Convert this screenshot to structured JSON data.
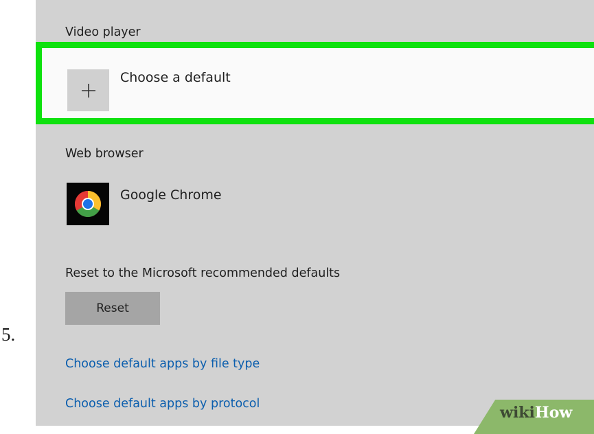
{
  "step_number": "5.",
  "video_player": {
    "section_label": "Video player",
    "choose_default_label": "Choose a default"
  },
  "web_browser": {
    "section_label": "Web browser",
    "app_name": "Google Chrome",
    "app_icon": "chrome-logo-icon"
  },
  "reset": {
    "section_label": "Reset to the Microsoft recommended defaults",
    "button_label": "Reset"
  },
  "links": {
    "by_file_type": "Choose default apps by file type",
    "by_protocol": "Choose default apps by protocol"
  },
  "watermark": {
    "part1": "wiki",
    "part2": "How"
  },
  "colors": {
    "highlight": "#0ee10e",
    "panel_background": "#d2d2d2",
    "link": "#0b5eae",
    "reset_button": "#a5a5a5"
  }
}
